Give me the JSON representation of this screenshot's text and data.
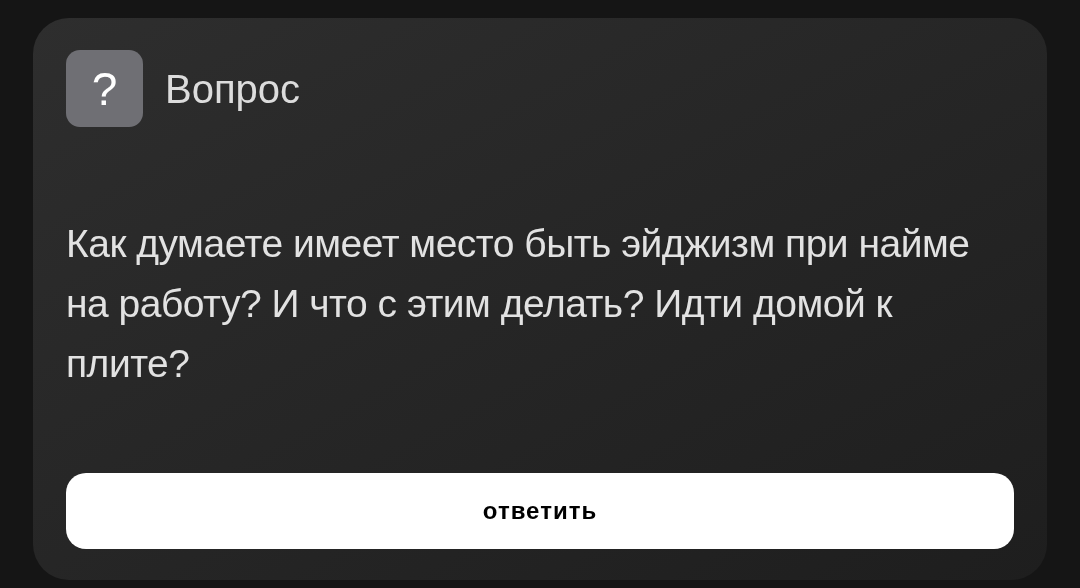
{
  "card": {
    "icon": "?",
    "title": "Вопрос",
    "question": "Как думаете имеет место быть эйджизм при найме на работу? И что с этим делать? Идти домой к плите?",
    "button": "ответить"
  }
}
